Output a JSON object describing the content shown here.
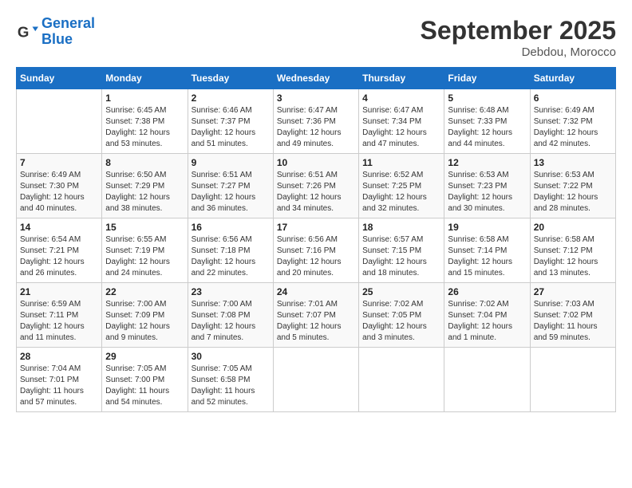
{
  "header": {
    "logo_line1": "General",
    "logo_line2": "Blue",
    "month": "September 2025",
    "location": "Debdou, Morocco"
  },
  "weekdays": [
    "Sunday",
    "Monday",
    "Tuesday",
    "Wednesday",
    "Thursday",
    "Friday",
    "Saturday"
  ],
  "weeks": [
    [
      {
        "day": "",
        "info": ""
      },
      {
        "day": "1",
        "info": "Sunrise: 6:45 AM\nSunset: 7:38 PM\nDaylight: 12 hours\nand 53 minutes."
      },
      {
        "day": "2",
        "info": "Sunrise: 6:46 AM\nSunset: 7:37 PM\nDaylight: 12 hours\nand 51 minutes."
      },
      {
        "day": "3",
        "info": "Sunrise: 6:47 AM\nSunset: 7:36 PM\nDaylight: 12 hours\nand 49 minutes."
      },
      {
        "day": "4",
        "info": "Sunrise: 6:47 AM\nSunset: 7:34 PM\nDaylight: 12 hours\nand 47 minutes."
      },
      {
        "day": "5",
        "info": "Sunrise: 6:48 AM\nSunset: 7:33 PM\nDaylight: 12 hours\nand 44 minutes."
      },
      {
        "day": "6",
        "info": "Sunrise: 6:49 AM\nSunset: 7:32 PM\nDaylight: 12 hours\nand 42 minutes."
      }
    ],
    [
      {
        "day": "7",
        "info": "Sunrise: 6:49 AM\nSunset: 7:30 PM\nDaylight: 12 hours\nand 40 minutes."
      },
      {
        "day": "8",
        "info": "Sunrise: 6:50 AM\nSunset: 7:29 PM\nDaylight: 12 hours\nand 38 minutes."
      },
      {
        "day": "9",
        "info": "Sunrise: 6:51 AM\nSunset: 7:27 PM\nDaylight: 12 hours\nand 36 minutes."
      },
      {
        "day": "10",
        "info": "Sunrise: 6:51 AM\nSunset: 7:26 PM\nDaylight: 12 hours\nand 34 minutes."
      },
      {
        "day": "11",
        "info": "Sunrise: 6:52 AM\nSunset: 7:25 PM\nDaylight: 12 hours\nand 32 minutes."
      },
      {
        "day": "12",
        "info": "Sunrise: 6:53 AM\nSunset: 7:23 PM\nDaylight: 12 hours\nand 30 minutes."
      },
      {
        "day": "13",
        "info": "Sunrise: 6:53 AM\nSunset: 7:22 PM\nDaylight: 12 hours\nand 28 minutes."
      }
    ],
    [
      {
        "day": "14",
        "info": "Sunrise: 6:54 AM\nSunset: 7:21 PM\nDaylight: 12 hours\nand 26 minutes."
      },
      {
        "day": "15",
        "info": "Sunrise: 6:55 AM\nSunset: 7:19 PM\nDaylight: 12 hours\nand 24 minutes."
      },
      {
        "day": "16",
        "info": "Sunrise: 6:56 AM\nSunset: 7:18 PM\nDaylight: 12 hours\nand 22 minutes."
      },
      {
        "day": "17",
        "info": "Sunrise: 6:56 AM\nSunset: 7:16 PM\nDaylight: 12 hours\nand 20 minutes."
      },
      {
        "day": "18",
        "info": "Sunrise: 6:57 AM\nSunset: 7:15 PM\nDaylight: 12 hours\nand 18 minutes."
      },
      {
        "day": "19",
        "info": "Sunrise: 6:58 AM\nSunset: 7:14 PM\nDaylight: 12 hours\nand 15 minutes."
      },
      {
        "day": "20",
        "info": "Sunrise: 6:58 AM\nSunset: 7:12 PM\nDaylight: 12 hours\nand 13 minutes."
      }
    ],
    [
      {
        "day": "21",
        "info": "Sunrise: 6:59 AM\nSunset: 7:11 PM\nDaylight: 12 hours\nand 11 minutes."
      },
      {
        "day": "22",
        "info": "Sunrise: 7:00 AM\nSunset: 7:09 PM\nDaylight: 12 hours\nand 9 minutes."
      },
      {
        "day": "23",
        "info": "Sunrise: 7:00 AM\nSunset: 7:08 PM\nDaylight: 12 hours\nand 7 minutes."
      },
      {
        "day": "24",
        "info": "Sunrise: 7:01 AM\nSunset: 7:07 PM\nDaylight: 12 hours\nand 5 minutes."
      },
      {
        "day": "25",
        "info": "Sunrise: 7:02 AM\nSunset: 7:05 PM\nDaylight: 12 hours\nand 3 minutes."
      },
      {
        "day": "26",
        "info": "Sunrise: 7:02 AM\nSunset: 7:04 PM\nDaylight: 12 hours\nand 1 minute."
      },
      {
        "day": "27",
        "info": "Sunrise: 7:03 AM\nSunset: 7:02 PM\nDaylight: 11 hours\nand 59 minutes."
      }
    ],
    [
      {
        "day": "28",
        "info": "Sunrise: 7:04 AM\nSunset: 7:01 PM\nDaylight: 11 hours\nand 57 minutes."
      },
      {
        "day": "29",
        "info": "Sunrise: 7:05 AM\nSunset: 7:00 PM\nDaylight: 11 hours\nand 54 minutes."
      },
      {
        "day": "30",
        "info": "Sunrise: 7:05 AM\nSunset: 6:58 PM\nDaylight: 11 hours\nand 52 minutes."
      },
      {
        "day": "",
        "info": ""
      },
      {
        "day": "",
        "info": ""
      },
      {
        "day": "",
        "info": ""
      },
      {
        "day": "",
        "info": ""
      }
    ]
  ]
}
